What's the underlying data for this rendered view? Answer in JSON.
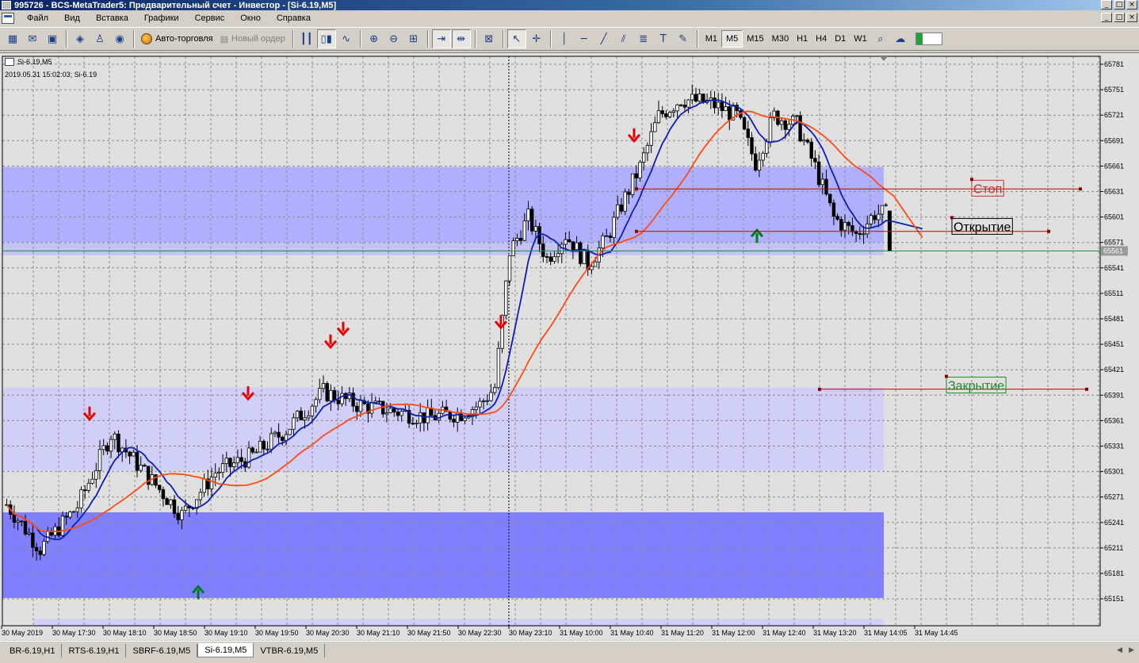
{
  "window": {
    "title": "995726 - BCS-MetaTrader5: Предварительный счет - Инвестор - [Si-6.19,M5]",
    "controls": {
      "minimize": "_",
      "maximize": "□",
      "close": "×"
    }
  },
  "menu": {
    "items": [
      "Файл",
      "Вид",
      "Вставка",
      "Графики",
      "Сервис",
      "Окно",
      "Справка"
    ]
  },
  "toolbar": {
    "autotrade_label": "Авто-торговля",
    "new_order_label": "Новый ордер",
    "timeframes": [
      "M1",
      "M5",
      "M15",
      "M30",
      "H1",
      "H4",
      "D1",
      "W1"
    ],
    "active_timeframe": "M5"
  },
  "chart": {
    "symbol_label": "Si-6.19,M5",
    "timestamp_label": "2019.05.31 15:02:03; Si-6.19",
    "current_price_label": "65561",
    "labels": {
      "stop": "Стоп",
      "open": "Открытие",
      "close": "Закрытие"
    },
    "colors": {
      "background": "#e0e0e0",
      "grid": "#8a8a8a",
      "bull_candle": "#ffffff",
      "bear_candle": "#000000",
      "ma_fast": "#0a1fb4",
      "ma_slow": "#ff4b12",
      "down_arrow": "#e60000",
      "up_arrow": "#007a1f",
      "zone_dark": "#8080ff",
      "zone_mid": "#b0b0ff",
      "zone_light": "#cfcff8",
      "trade_line": "#c00000",
      "price_line": "#1a8a3a"
    }
  },
  "chart_data": {
    "type": "candlestick",
    "symbol": "Si-6.19",
    "timeframe": "M5",
    "y_ticks": [
      65781,
      65751,
      65721,
      65691,
      65661,
      65631,
      65601,
      65571,
      65541,
      65511,
      65481,
      65451,
      65421,
      65391,
      65361,
      65331,
      65301,
      65271,
      65241,
      65211,
      65181,
      65151
    ],
    "x_ticks": [
      "30 May 2019",
      "30 May 17:30",
      "30 May 18:10",
      "30 May 18:50",
      "30 May 19:10",
      "30 May 19:50",
      "30 May 20:30",
      "30 May 21:10",
      "30 May 21:50",
      "30 May 22:30",
      "30 May 23:10",
      "31 May 10:00",
      "31 May 10:40",
      "31 May 11:20",
      "31 May 12:00",
      "31 May 12:40",
      "31 May 13:20",
      "31 May 14:05",
      "31 May 14:45"
    ],
    "ylim": [
      65140,
      65790
    ],
    "grid": true,
    "last_price": 65561,
    "stop_level": 65634,
    "open_level": 65584,
    "close_level": 65398
  }
}
